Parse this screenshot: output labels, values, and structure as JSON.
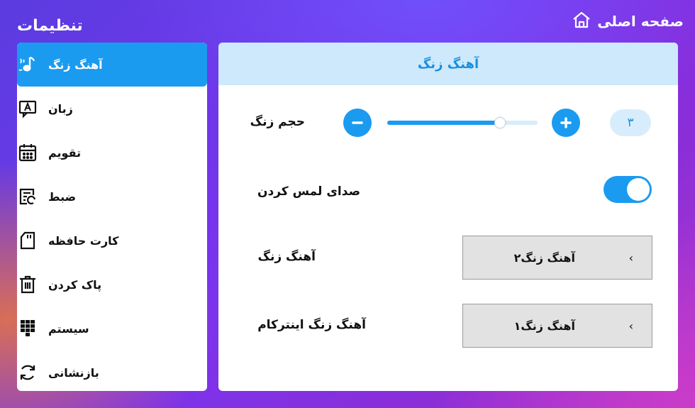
{
  "header": {
    "home_label": "صفحه اصلی",
    "settings_title": "تنظیمات"
  },
  "sidebar": {
    "items": [
      {
        "label": "آهنگ زنگ",
        "icon": "ringtone-icon",
        "active": true
      },
      {
        "label": "زبان",
        "icon": "language-icon"
      },
      {
        "label": "تقویم",
        "icon": "calendar-icon"
      },
      {
        "label": "ضبط",
        "icon": "record-icon"
      },
      {
        "label": "کارت حافظه",
        "icon": "sd-card-icon"
      },
      {
        "label": "پاک کردن",
        "icon": "trash-icon"
      },
      {
        "label": "سیستم",
        "icon": "system-grid-icon"
      },
      {
        "label": "بازنشانی",
        "icon": "reset-icon"
      }
    ]
  },
  "panel": {
    "title": "آهنگ زنگ",
    "volume": {
      "label": "حجم زنگ",
      "value": "۳",
      "level": 0.75
    },
    "touch_sound": {
      "label": "صدای لمس کردن",
      "on": true
    },
    "ringtone": {
      "label": "آهنگ زنگ",
      "value": "آهنگ زنگ۲",
      "chevron": "›"
    },
    "intercom_ringtone": {
      "label": "آهنگ زنگ اینترکام",
      "value": "آهنگ زنگ۱",
      "chevron": "›"
    }
  },
  "colors": {
    "accent": "#1a9bf0",
    "accent_light": "#d8edfb",
    "header_light": "#cde9fb"
  }
}
